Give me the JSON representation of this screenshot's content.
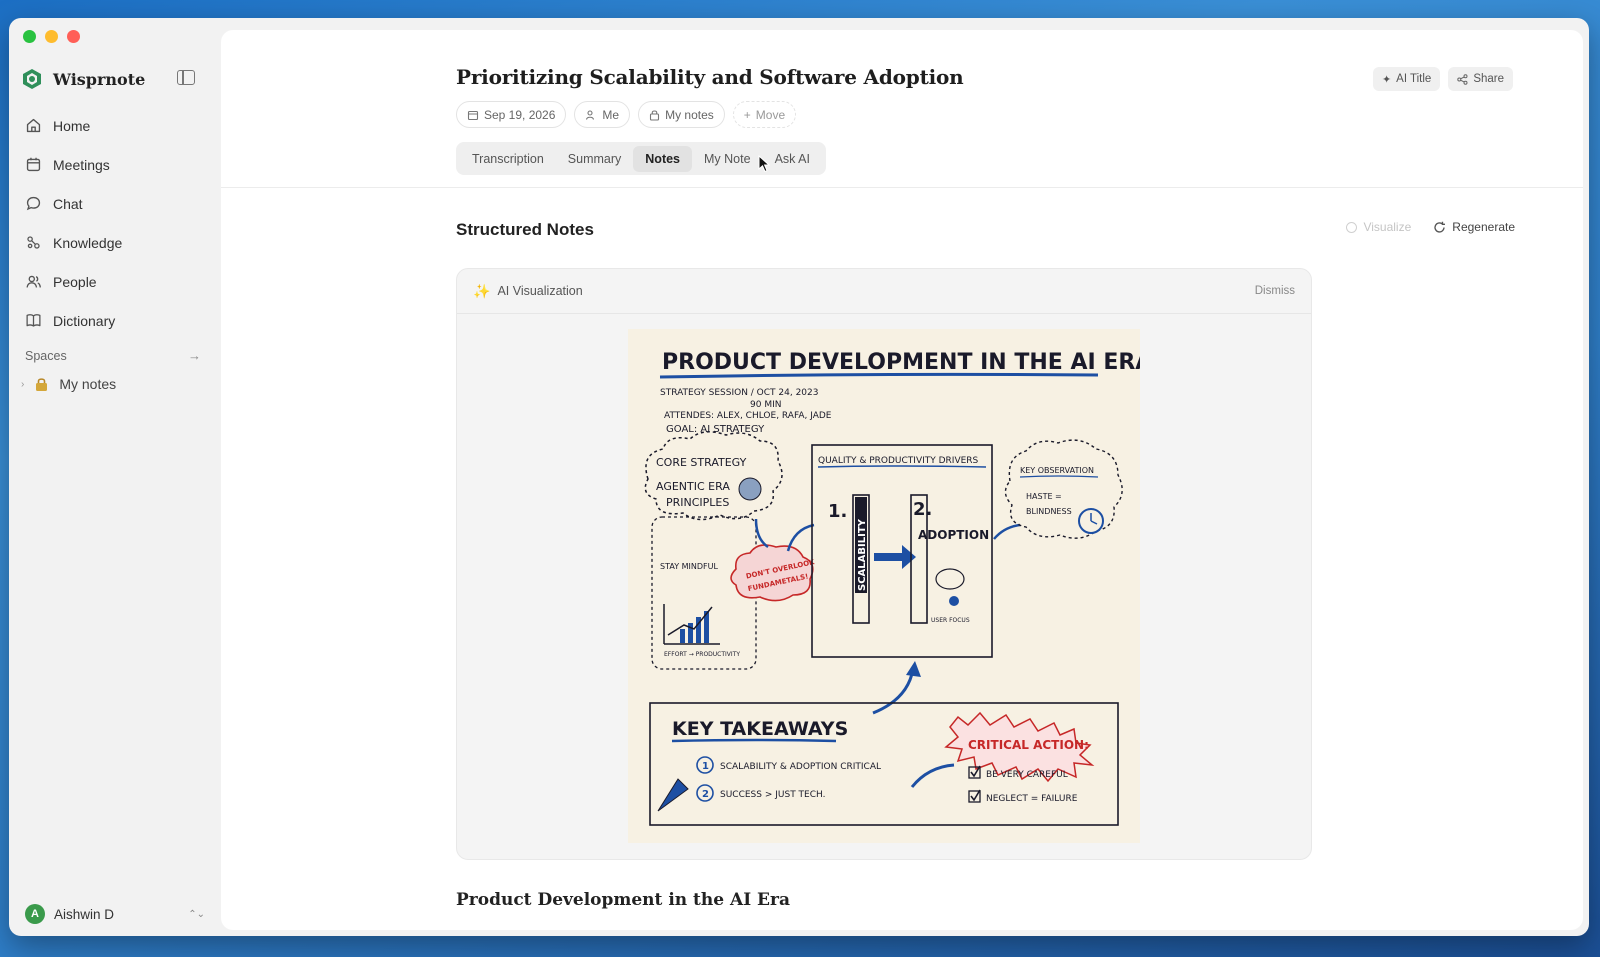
{
  "sidebar": {
    "brand": "Wisprnote",
    "items": [
      {
        "label": "Home",
        "icon": "home-icon"
      },
      {
        "label": "Meetings",
        "icon": "calendar-icon"
      },
      {
        "label": "Chat",
        "icon": "chat-icon"
      },
      {
        "label": "Knowledge",
        "icon": "knowledge-icon"
      },
      {
        "label": "People",
        "icon": "people-icon"
      },
      {
        "label": "Dictionary",
        "icon": "book-icon"
      }
    ],
    "spaces_label": "Spaces",
    "space_item": "My notes",
    "user": {
      "initial": "A",
      "name": "Aishwin D"
    }
  },
  "note": {
    "title": "Prioritizing Scalability and Software Adoption",
    "date": "Sep 19, 2026",
    "owner": "Me",
    "space": "My notes",
    "move": "Move",
    "ai_title": "AI Title",
    "share": "Share"
  },
  "tabs": [
    {
      "label": "Transcription",
      "active": false
    },
    {
      "label": "Summary",
      "active": false
    },
    {
      "label": "Notes",
      "active": true
    },
    {
      "label": "My Note",
      "active": false
    },
    {
      "label": "Ask AI",
      "active": false
    }
  ],
  "structured": {
    "title": "Structured Notes",
    "visualize": "Visualize",
    "regenerate": "Regenerate"
  },
  "viz": {
    "label": "AI Visualization",
    "dismiss": "Dismiss",
    "sketch": {
      "heading": "PRODUCT DEVELOPMENT IN THE AI ERA",
      "session": "STRATEGY SESSION / OCT 24, 2023",
      "duration": "90 MIN",
      "attendees": "ATTENDES: ALEX, CHLOE, RAFA, JADE",
      "goal": "GOAL: AI STRATEGY",
      "core_title": "CORE STRATEGY",
      "core_line1": "AGENTIC ERA",
      "core_line2": "PRINCIPLES",
      "stay_mindful": "STAY MINDFUL",
      "warning_line1": "DON'T OVERLOOK",
      "warning_line2": "FUNDAMETALS!",
      "effort": "EFFORT → PRODUCTIVITY",
      "drivers_title": "QUALITY & PRODUCTIVITY DRIVERS",
      "num1": "1.",
      "num2": "2.",
      "scalability": "SCALABILITY",
      "adoption": "ADOPTION",
      "user_focus": "USER FOCUS",
      "key_obs": "KEY OBSERVATION",
      "haste": "HASTE =",
      "blindness": "BLINDNESS",
      "takeaways": "KEY TAKEAWAYS",
      "t1": "SCALABILITY & ADOPTION CRITICAL",
      "t2": "SUCCESS > JUST TECH.",
      "critical": "CRITICAL ACTION:",
      "c1": "BE VERY CAREFUL",
      "c2": "NEGLECT = FAILURE"
    }
  },
  "subheading": "Product Development in the AI Era"
}
